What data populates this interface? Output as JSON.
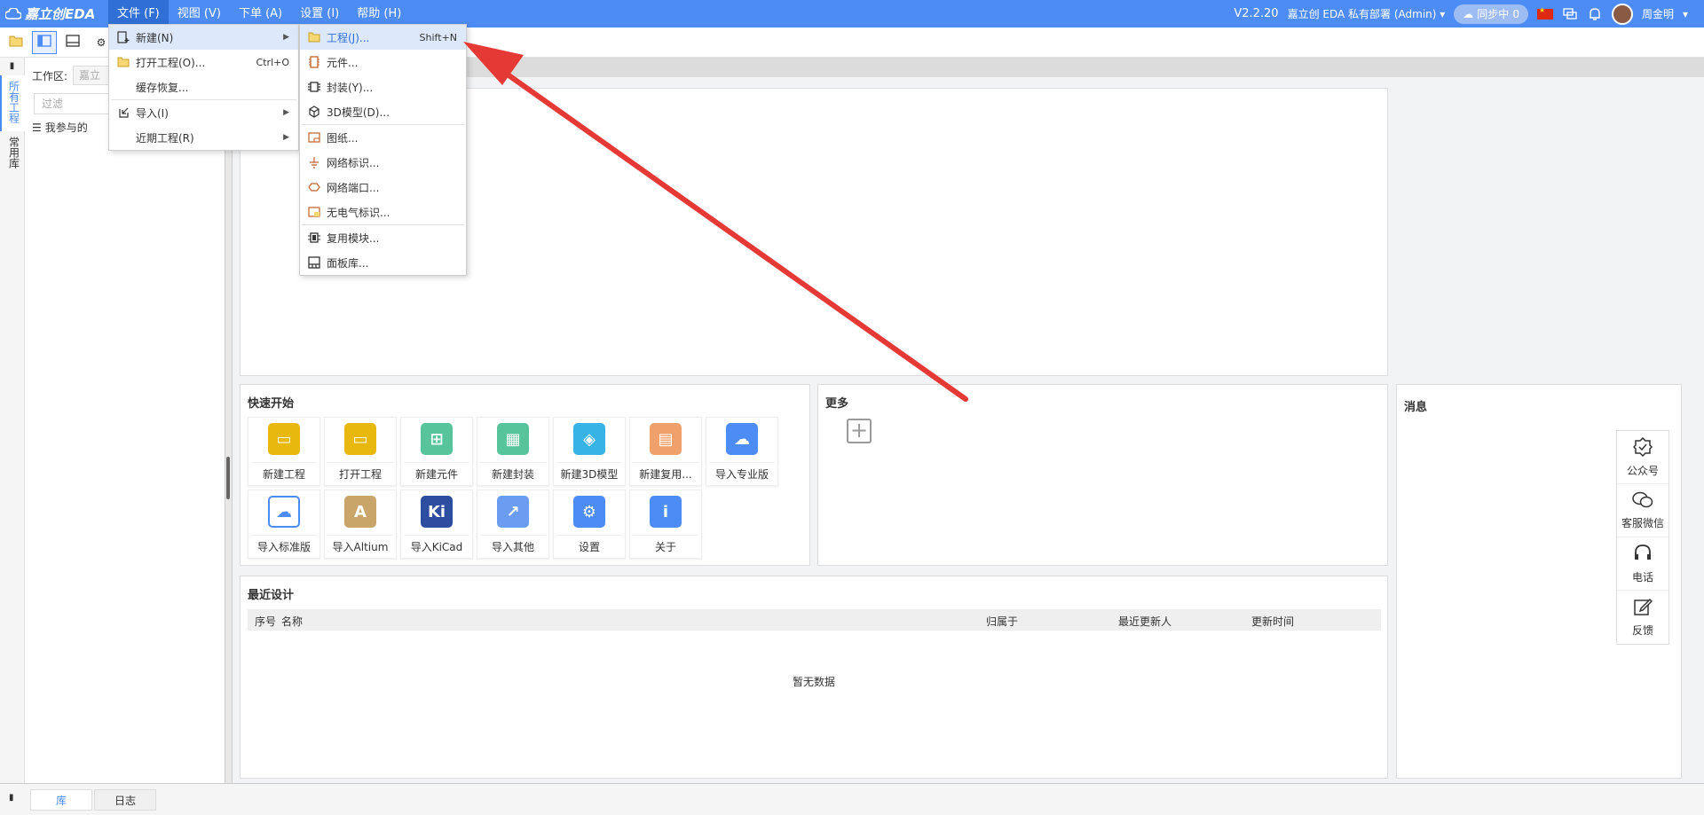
{
  "app": {
    "logo_text": "嘉立创EDA",
    "version": "V2.2.20",
    "org": "嘉立创 EDA 私有部署 (Admin)",
    "sync_label": "同步中",
    "sync_count": "0",
    "user": "周金明"
  },
  "menubar": [
    {
      "label": "文件 (F)"
    },
    {
      "label": "视图 (V)"
    },
    {
      "label": "下单 (A)"
    },
    {
      "label": "设置 (I)"
    },
    {
      "label": "帮助 (H)"
    }
  ],
  "file_menu": [
    {
      "label": "新建(N)",
      "shortcut": "",
      "submenu": true,
      "icon": "new-file-icon"
    },
    {
      "label": "打开工程(O)...",
      "shortcut": "Ctrl+O",
      "submenu": false,
      "icon": "folder-icon"
    },
    {
      "label": "缓存恢复...",
      "shortcut": "",
      "submenu": false,
      "icon": ""
    },
    {
      "label": "导入(I)",
      "shortcut": "",
      "submenu": true,
      "icon": "import-icon"
    },
    {
      "label": "近期工程(R)",
      "shortcut": "",
      "submenu": true,
      "icon": ""
    }
  ],
  "new_menu": [
    {
      "label": "工程(J)...",
      "shortcut": "Shift+N",
      "icon": "folder-icon"
    },
    {
      "label": "元件...",
      "shortcut": "",
      "icon": "component-icon"
    },
    {
      "label": "封装(Y)...",
      "shortcut": "",
      "icon": "footprint-icon"
    },
    {
      "label": "3D模型(D)...",
      "shortcut": "",
      "icon": "3d-model-icon"
    },
    {
      "label": "图纸...",
      "shortcut": "",
      "icon": "sheet-icon"
    },
    {
      "label": "网络标识...",
      "shortcut": "",
      "icon": "net-label-icon"
    },
    {
      "label": "网络端口...",
      "shortcut": "",
      "icon": "net-port-icon"
    },
    {
      "label": "无电气标识...",
      "shortcut": "",
      "icon": "non-electrical-icon"
    },
    {
      "label": "复用模块...",
      "shortcut": "",
      "icon": "reuse-block-icon"
    },
    {
      "label": "面板库...",
      "shortcut": "",
      "icon": "panel-library-icon"
    }
  ],
  "workspace": {
    "label": "工作区:",
    "select_value": "嘉立",
    "filter_placeholder": "过滤",
    "tree_item": "我参与的"
  },
  "vertical_tabs": [
    {
      "label": "所有工程"
    },
    {
      "label": "常用库"
    }
  ],
  "quick_start": {
    "title": "快速开始",
    "items": [
      {
        "label": "新建工程",
        "color": "#e8b80e",
        "glyph": "▭",
        "icon": "folder-icon"
      },
      {
        "label": "打开工程",
        "color": "#e8b80e",
        "glyph": "▭",
        "icon": "folder-icon"
      },
      {
        "label": "新建元件",
        "color": "#58c49b",
        "glyph": "⊞",
        "icon": "component-icon"
      },
      {
        "label": "新建封装",
        "color": "#58c49b",
        "glyph": "▦",
        "icon": "footprint-icon"
      },
      {
        "label": "新建3D模型",
        "color": "#37b3e5",
        "glyph": "◈",
        "icon": "3d-model-icon"
      },
      {
        "label": "新建复用...",
        "color": "#f0a06b",
        "glyph": "▤",
        "icon": "reuse-block-icon"
      },
      {
        "label": "导入专业版",
        "color": "#4d8cf5",
        "glyph": "☁",
        "icon": "cloud-pro-icon"
      },
      {
        "label": "导入标准版",
        "color": "#ffffff",
        "glyph": "☁",
        "icon": "cloud-std-icon"
      },
      {
        "label": "导入Altium",
        "color": "#c9a56a",
        "glyph": "A",
        "icon": "altium-icon"
      },
      {
        "label": "导入KiCad",
        "color": "#2d4da0",
        "glyph": "Ki",
        "icon": "kicad-icon"
      },
      {
        "label": "导入其他",
        "color": "#6a9df2",
        "glyph": "↗",
        "icon": "import-more-icon"
      },
      {
        "label": "设置",
        "color": "#4d8cf5",
        "glyph": "⚙",
        "icon": "gear-icon"
      },
      {
        "label": "关于",
        "color": "#4d8cf5",
        "glyph": "i",
        "icon": "info-icon"
      }
    ]
  },
  "more": {
    "title": "更多"
  },
  "messages": {
    "title": "消息"
  },
  "recent": {
    "title": "最近设计",
    "columns": [
      "序号",
      "名称",
      "归属于",
      "最近更新人",
      "更新时间"
    ],
    "empty_text": "暂无数据"
  },
  "side_float": [
    {
      "label": "公众号",
      "icon": "badge-check-icon"
    },
    {
      "label": "客服微信",
      "icon": "wechat-icon"
    },
    {
      "label": "电话",
      "icon": "headset-icon"
    },
    {
      "label": "反馈",
      "icon": "edit-icon"
    }
  ],
  "bottom_tabs": [
    {
      "label": "库"
    },
    {
      "label": "日志"
    }
  ],
  "colors": {
    "accent": "#4d8cf5",
    "arrow": "#e53935"
  }
}
